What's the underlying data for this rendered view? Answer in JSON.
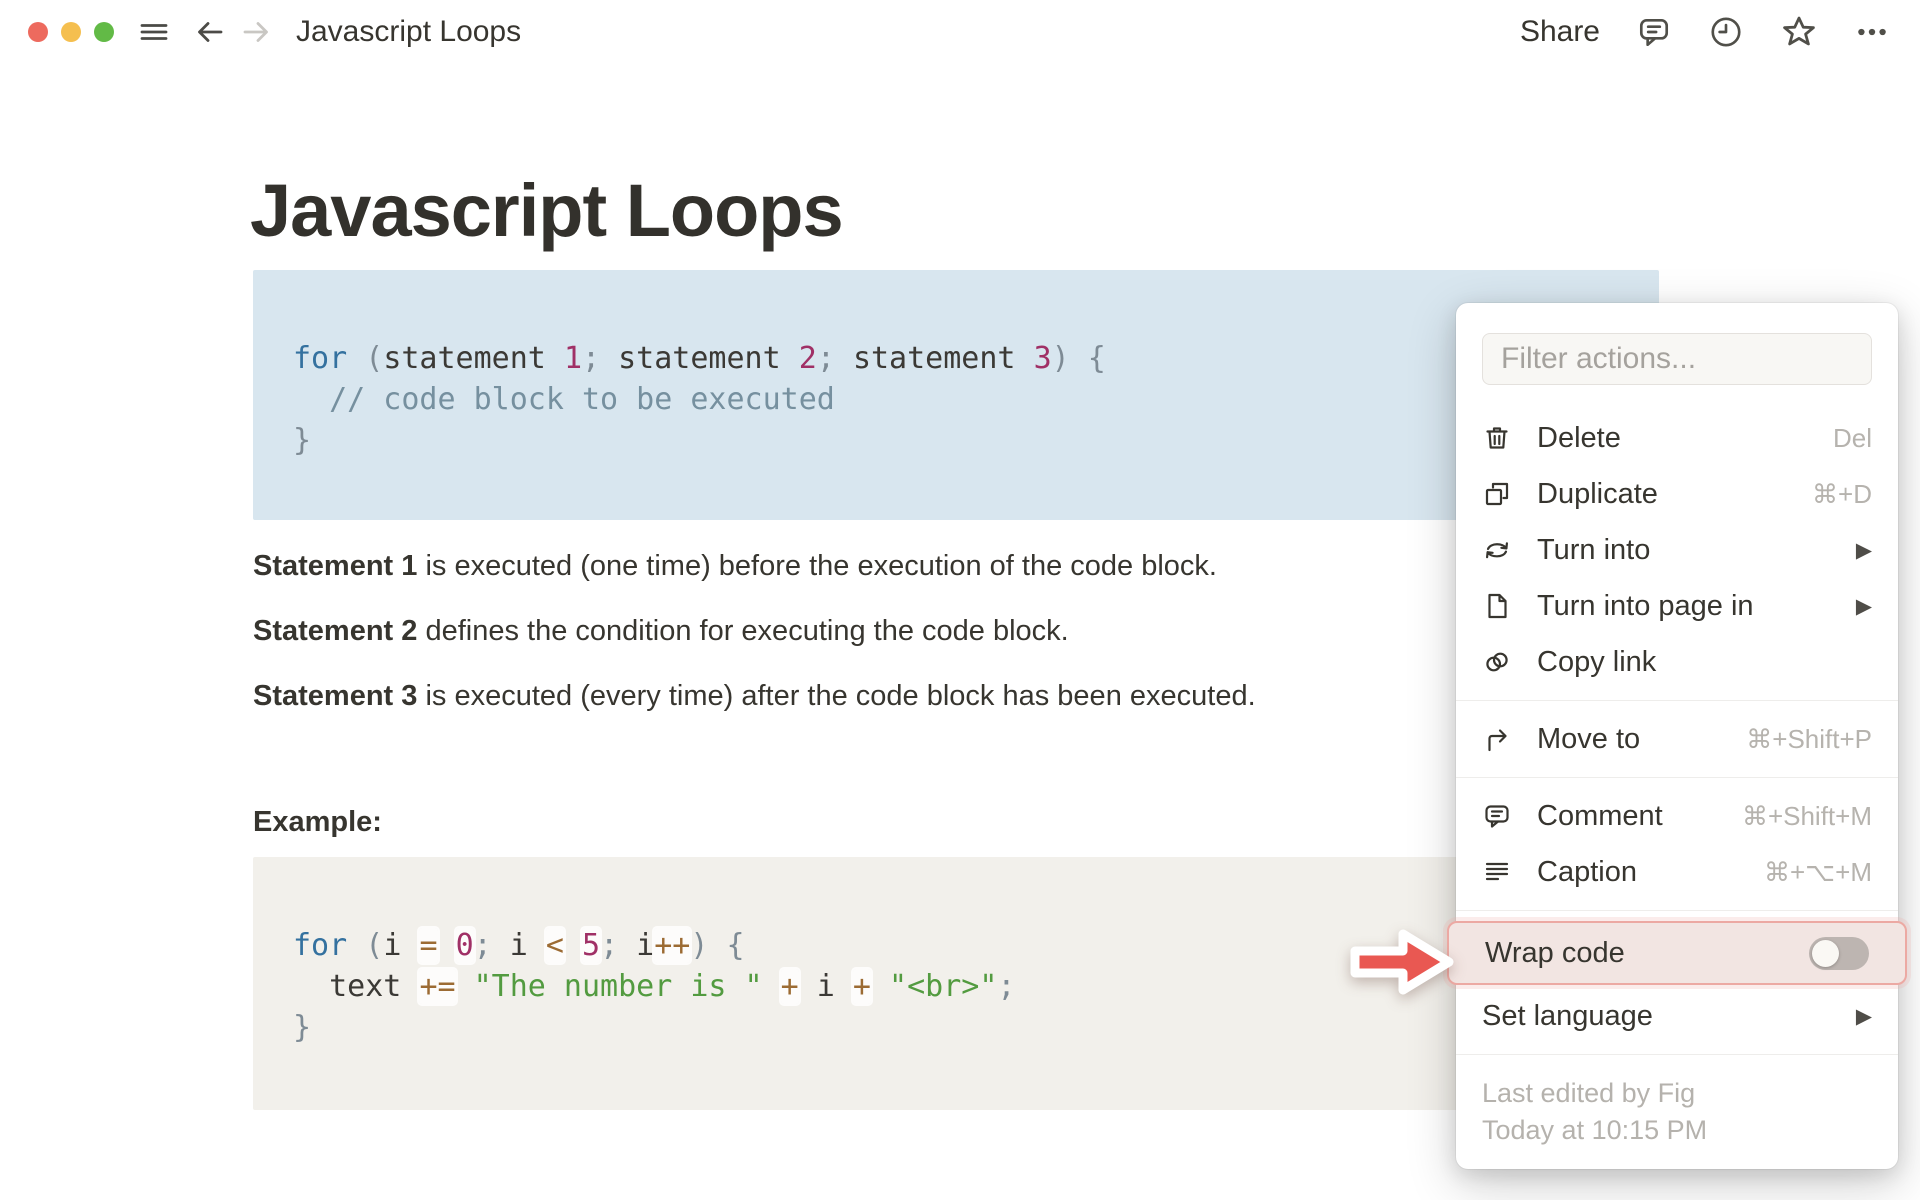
{
  "topbar": {
    "title": "Javascript Loops",
    "share_label": "Share"
  },
  "page": {
    "title": "Javascript Loops"
  },
  "paragraphs": [
    {
      "lead": "Statement 1",
      "rest": " is executed (one time) before the execution of the code block."
    },
    {
      "lead": "Statement 2",
      "rest": " defines the condition for executing the code block."
    },
    {
      "lead": "Statement 3",
      "rest": " is executed (every time) after the code block has been executed."
    }
  ],
  "example_label": "Example:",
  "code_blocks": [
    {
      "name": "for-loop-syntax",
      "background": "#d8e6ef",
      "highlight_ops": false,
      "lines": [
        [
          {
            "t": "k",
            "v": "for"
          },
          {
            "t": "p",
            "v": " ("
          },
          {
            "t": "t",
            "v": "statement "
          },
          {
            "t": "n",
            "v": "1"
          },
          {
            "t": "p",
            "v": "; "
          },
          {
            "t": "t",
            "v": "statement "
          },
          {
            "t": "n",
            "v": "2"
          },
          {
            "t": "p",
            "v": "; "
          },
          {
            "t": "t",
            "v": "statement "
          },
          {
            "t": "n",
            "v": "3"
          },
          {
            "t": "p",
            "v": ") {"
          }
        ],
        [
          {
            "t": "t",
            "v": "  "
          },
          {
            "t": "c",
            "v": "// code block to be executed"
          }
        ],
        [
          {
            "t": "p",
            "v": "}"
          }
        ]
      ]
    },
    {
      "name": "for-loop-example",
      "background": "#f2f0eb",
      "highlight_ops": true,
      "lines": [
        [
          {
            "t": "k",
            "v": "for"
          },
          {
            "t": "p",
            "v": " ("
          },
          {
            "t": "t",
            "v": "i "
          },
          {
            "t": "o",
            "v": "="
          },
          {
            "t": "t",
            "v": " "
          },
          {
            "t": "n",
            "v": "0"
          },
          {
            "t": "p",
            "v": "; "
          },
          {
            "t": "t",
            "v": "i "
          },
          {
            "t": "o",
            "v": "<"
          },
          {
            "t": "t",
            "v": " "
          },
          {
            "t": "n",
            "v": "5"
          },
          {
            "t": "p",
            "v": "; "
          },
          {
            "t": "t",
            "v": "i"
          },
          {
            "t": "o",
            "v": "++"
          },
          {
            "t": "p",
            "v": ") {"
          }
        ],
        [
          {
            "t": "t",
            "v": "  text "
          },
          {
            "t": "o",
            "v": "+="
          },
          {
            "t": "t",
            "v": " "
          },
          {
            "t": "s",
            "v": "\"The number is \""
          },
          {
            "t": "t",
            "v": " "
          },
          {
            "t": "o",
            "v": "+"
          },
          {
            "t": "t",
            "v": " i "
          },
          {
            "t": "o",
            "v": "+"
          },
          {
            "t": "t",
            "v": " "
          },
          {
            "t": "s",
            "v": "\"<br>\""
          },
          {
            "t": "p",
            "v": ";"
          }
        ],
        [
          {
            "t": "p",
            "v": "}"
          }
        ]
      ]
    }
  ],
  "menu": {
    "filter_placeholder": "Filter actions...",
    "sections": [
      {
        "items": [
          {
            "icon": "trash-icon",
            "label": "Delete",
            "shortcut": "Del"
          },
          {
            "icon": "duplicate-icon",
            "label": "Duplicate",
            "shortcut": "⌘+D"
          },
          {
            "icon": "turn-into-icon",
            "label": "Turn into",
            "submenu": true
          },
          {
            "icon": "page-icon",
            "label": "Turn into page in",
            "submenu": true
          },
          {
            "icon": "link-icon",
            "label": "Copy link"
          }
        ]
      },
      {
        "items": [
          {
            "icon": "move-to-icon",
            "label": "Move to",
            "shortcut": "⌘+Shift+P"
          }
        ]
      },
      {
        "items": [
          {
            "icon": "comment-icon",
            "label": "Comment",
            "shortcut": "⌘+Shift+M"
          },
          {
            "icon": "caption-icon",
            "label": "Caption",
            "shortcut": "⌘+⌥+M"
          }
        ]
      },
      {
        "items": [
          {
            "label": "Wrap code",
            "toggle": "off",
            "highlighted": true
          },
          {
            "label": "Set language",
            "submenu": true
          }
        ]
      }
    ],
    "footer": {
      "line1": "Last edited by Fig",
      "line2": "Today at 10:15 PM"
    }
  },
  "colors": {
    "accent_arrow": "#e95852",
    "highlight_row_bg": "#f2e5e2",
    "highlight_row_border": "#eca9a3",
    "code_block_blue": "#d8e6ef",
    "code_block_gray": "#f2f0eb",
    "traffic_red": "#ed6a5e",
    "traffic_yellow": "#f5bf4f",
    "traffic_green": "#62ba46"
  }
}
